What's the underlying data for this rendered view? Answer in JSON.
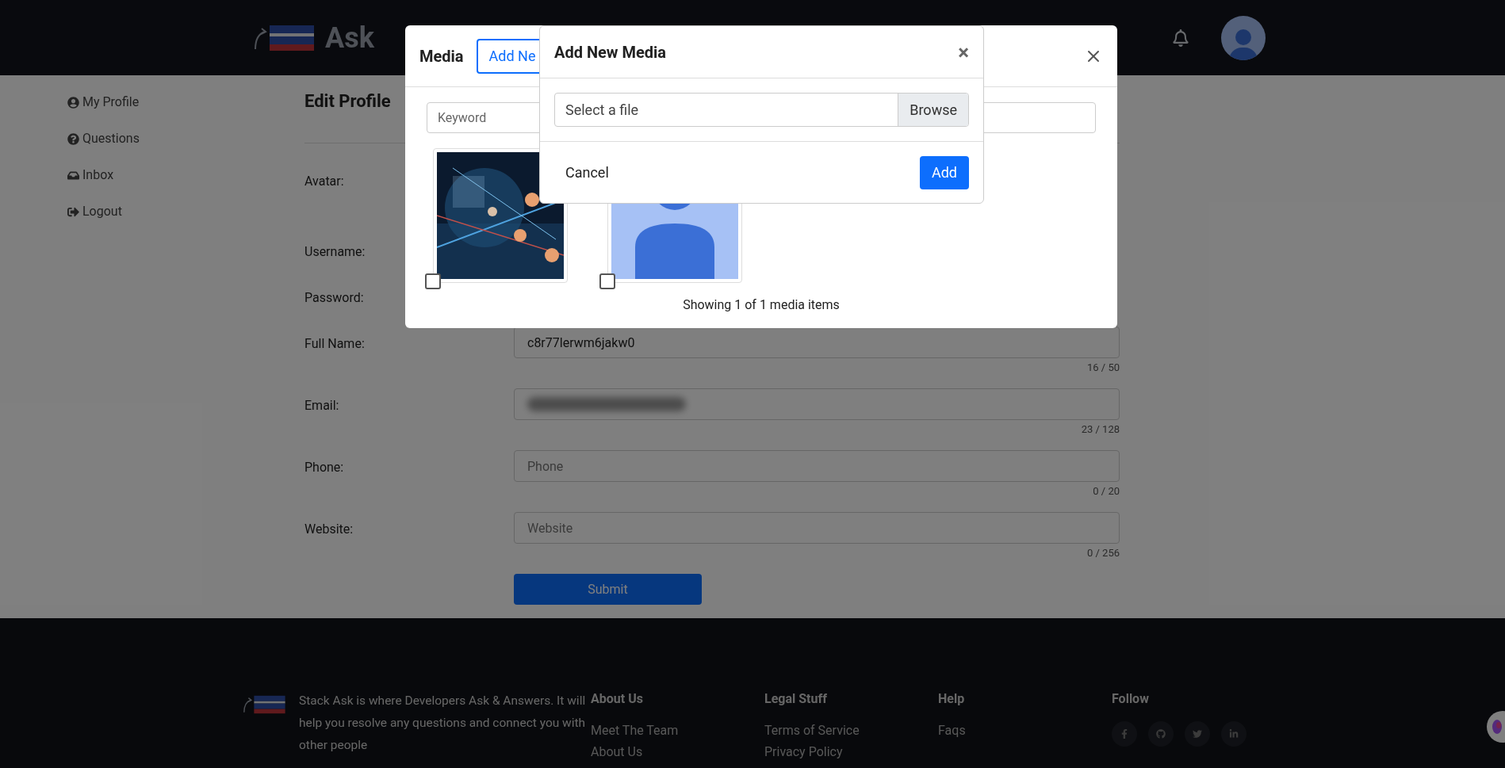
{
  "header": {
    "logo_text": "Ask"
  },
  "sidebar": {
    "items": [
      {
        "label": "My Profile",
        "kind": "profile"
      },
      {
        "label": "Questions",
        "kind": "questions"
      },
      {
        "label": "Inbox",
        "kind": "inbox"
      },
      {
        "label": "Logout",
        "kind": "logout"
      }
    ]
  },
  "page_title": "Edit Profile",
  "form": {
    "fields": [
      {
        "label": "Avatar:",
        "kind": "avatar"
      },
      {
        "label": "Username:",
        "kind": "hidden"
      },
      {
        "label": "Password:",
        "kind": "hidden"
      },
      {
        "label": "Full Name:",
        "kind": "text",
        "value": "c8r77lerwm6jakw0",
        "counter": "16 / 50"
      },
      {
        "label": "Email:",
        "kind": "blurred",
        "counter": "23 / 128"
      },
      {
        "label": "Phone:",
        "kind": "text",
        "placeholder": "Phone",
        "counter": "0 / 20"
      },
      {
        "label": "Website:",
        "kind": "text",
        "placeholder": "Website",
        "counter": "0 / 256"
      }
    ],
    "submit": "Submit"
  },
  "media_modal": {
    "title": "Media",
    "add_button": "Add Ne",
    "search": {
      "placeholder": "Keyword"
    },
    "items": [
      {
        "kind": "picture",
        "checked": false
      },
      {
        "kind": "silhouette",
        "checked": false
      }
    ],
    "status": "Showing 1 of 1 media items"
  },
  "add_media_modal": {
    "title": "Add New Media",
    "close": "×",
    "file": {
      "placeholder": "Select a file"
    },
    "browse": "Browse",
    "cancel": "Cancel",
    "add": "Add"
  },
  "footer": {
    "description": "Stack Ask is where Developers Ask & Answers. It will help you resolve any questions and connect you with other people",
    "columns": [
      {
        "heading": "About Us",
        "links": [
          "Meet The Team",
          "About Us"
        ]
      },
      {
        "heading": "Legal Stuff",
        "links": [
          "Terms of Service",
          "Privacy Policy"
        ]
      },
      {
        "heading": "Help",
        "links": [
          "Faqs"
        ]
      }
    ],
    "follow": {
      "heading": "Follow",
      "networks": [
        {
          "kind": "facebook"
        },
        {
          "kind": "github"
        },
        {
          "kind": "twitter"
        },
        {
          "kind": "linkedin"
        }
      ]
    }
  }
}
